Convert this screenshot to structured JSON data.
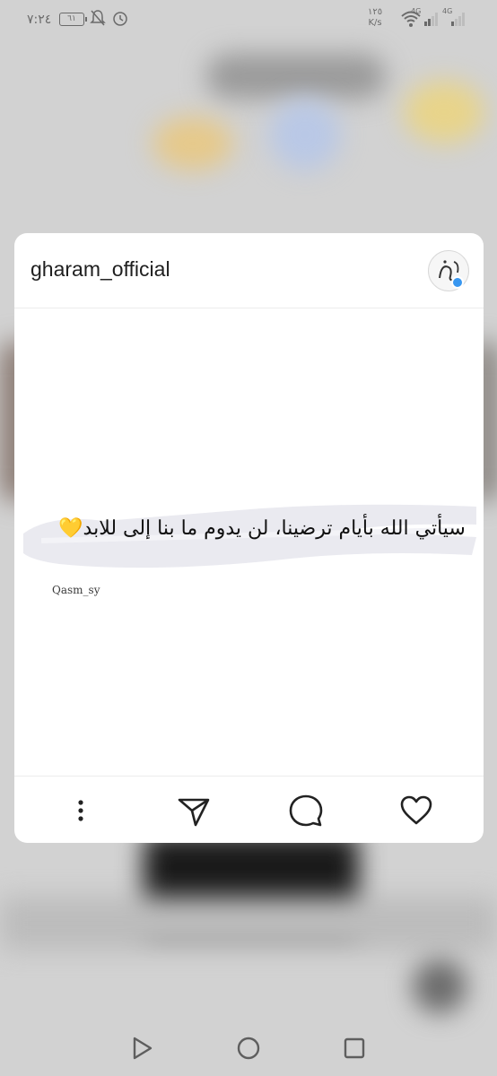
{
  "status_bar": {
    "time": "٧:٢٤",
    "battery": "٦١",
    "net_speed_value": "١٢٥",
    "net_speed_unit": "K/s",
    "signal_1": "4G",
    "signal_2": "4G"
  },
  "post": {
    "username": "gharam_official",
    "quote": "سيأتي الله بأيام ترضينا، لن يدوم ما بنا إلى للابد💛",
    "credit": "Qasm_sy"
  },
  "actions": {
    "more": "more-icon",
    "share": "send-icon",
    "comment": "comment-icon",
    "like": "heart-icon"
  },
  "colors": {
    "card_bg": "#ffffff",
    "backdrop": "#d2d2d2",
    "verified_badge": "#3897f0"
  }
}
